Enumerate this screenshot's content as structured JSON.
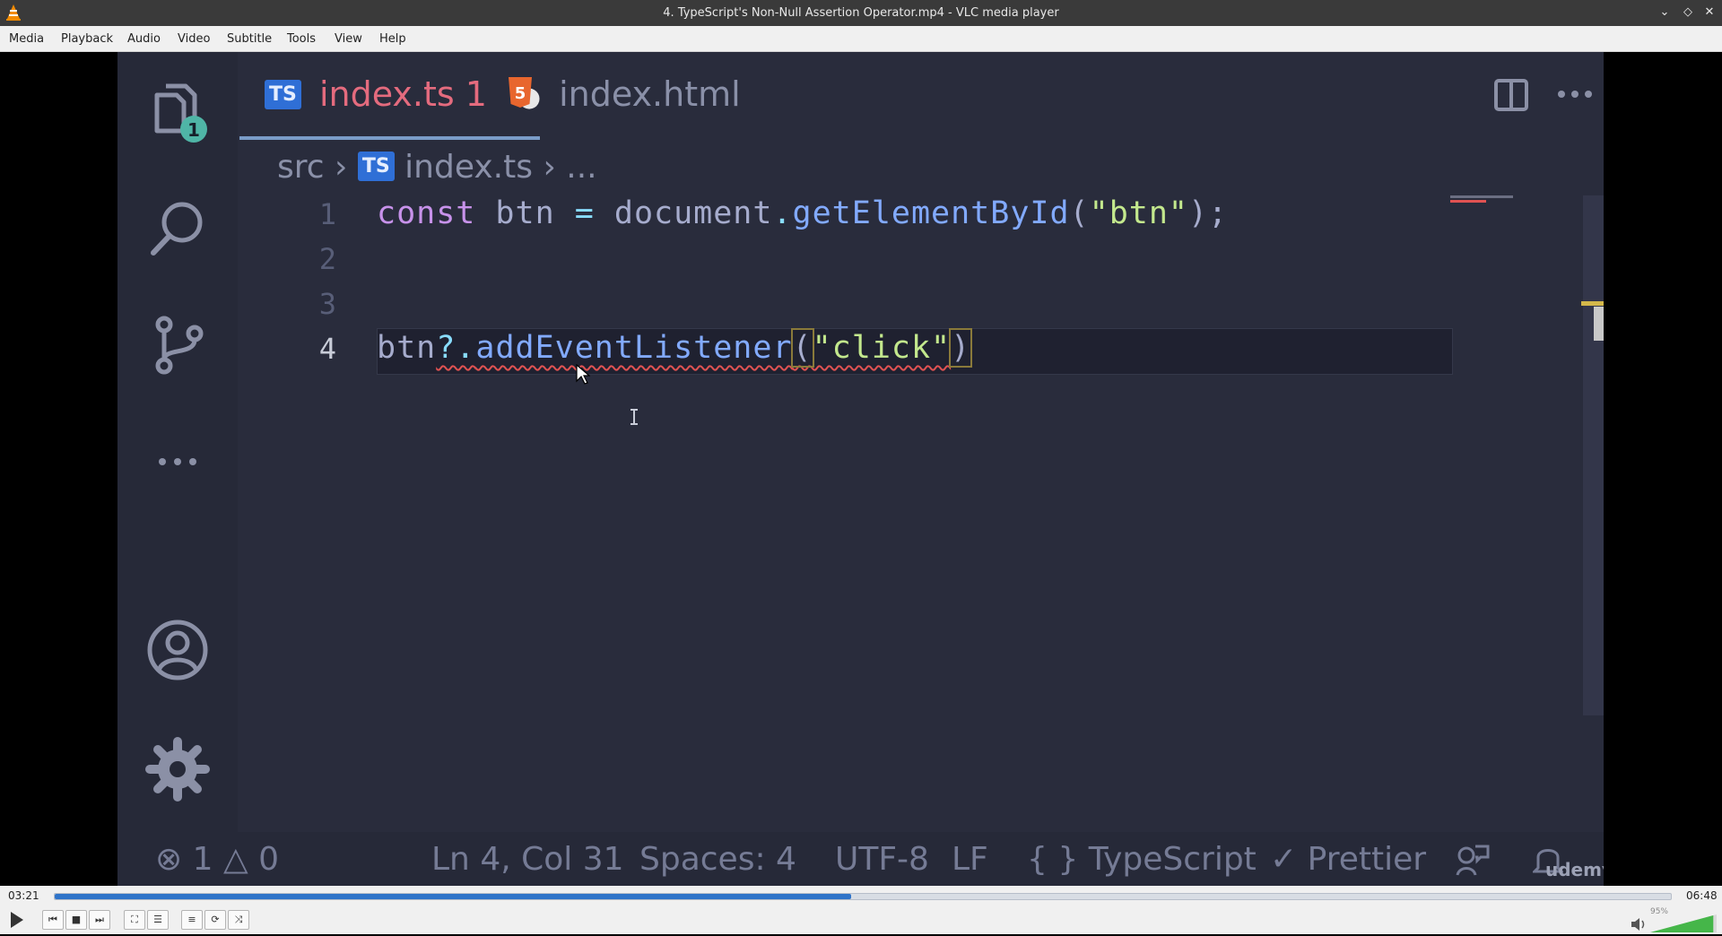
{
  "window": {
    "title": "4. TypeScript's Non-Null Assertion Operator.mp4 - VLC media player",
    "buttons": [
      "minimize",
      "maximize",
      "close"
    ]
  },
  "menu": [
    "Media",
    "Playback",
    "Audio",
    "Video",
    "Subtitle",
    "Tools",
    "View",
    "Help"
  ],
  "vscode": {
    "explorer_badge": "1",
    "tabs": [
      {
        "badge": "TS",
        "label": "index.ts 1",
        "active": true,
        "modified": true
      },
      {
        "badge": "5",
        "label": "index.html",
        "active": false
      }
    ],
    "breadcrumb": {
      "folder": "src",
      "badge": "TS",
      "file": "index.ts",
      "more": "..."
    },
    "line_numbers": [
      "1",
      "2",
      "3",
      "4"
    ],
    "code": {
      "line1": {
        "kw": "const",
        "var": " btn ",
        "op": "=",
        "obj": " document",
        "dot": ".",
        "fn": "getElementById",
        "open": "(",
        "str": "\"btn\"",
        "close": ");"
      },
      "line4": {
        "var": "btn",
        "op": "?.",
        "fn": "addEventListener",
        "open": "(",
        "str": "\"click\"",
        "close": ")"
      }
    },
    "status": {
      "errors": "1",
      "warnings": "0",
      "position": "Ln 4, Col 31",
      "spaces": "Spaces: 4",
      "encoding": "UTF-8",
      "eol": "LF",
      "language": "{ } TypeScript",
      "formatter": "Prettier",
      "watermark": "udemy"
    }
  },
  "player": {
    "elapsed": "03:21",
    "total": "06:48",
    "progress": 0.493,
    "volume_label": "95%",
    "volume": 0.95,
    "buttons": [
      "play",
      "previous",
      "stop",
      "next",
      "fullscreen",
      "extended-settings",
      "playlist",
      "loop",
      "random"
    ]
  }
}
